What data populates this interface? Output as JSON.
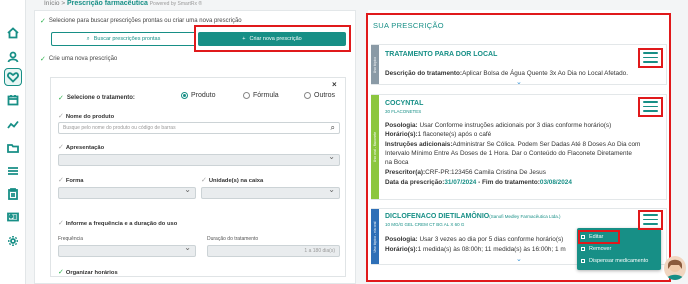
{
  "breadcrumb": {
    "home": "Início",
    "sep": ">",
    "current": "Prescrição farmacêutica",
    "powered": "Powered by SmartRx ®"
  },
  "sidebar_icons": [
    "home-icon",
    "user-icon",
    "heart-icon",
    "calendar-icon",
    "chart-icon",
    "folder-icon",
    "list-icon",
    "clipboard-icon",
    "id-card-icon",
    "settings-icon"
  ],
  "left": {
    "choose_label": "Selecione para buscar prescrições prontas ou criar uma nova prescrição",
    "search_btn": "Buscar prescrições prontas",
    "create_btn": "Criar nova prescrição",
    "new_label": "Crie uma nova prescrição",
    "close": "×",
    "treatment_label": "Selecione o tratamento:",
    "radios": [
      "Produto",
      "Fórmula",
      "Outros"
    ],
    "product_label": "Nome do produto",
    "product_placeholder": "Busque pelo nome do produto ou código de barras",
    "presentation_label": "Apresentação",
    "form_label": "Forma",
    "units_label": "Unidade(s) na caixa",
    "freq_section": "Informe a frequência e a duração do uso",
    "freq_label": "Frequência",
    "duration_label": "Duração do tratamento",
    "duration_value": "1 a 180 dia(s)",
    "organize_label": "Organizar horários"
  },
  "right": {
    "title": "SUA PRESCRIÇÃO",
    "cards": [
      {
        "strip_label": "Uso tópico",
        "strip_color": "#8a9aa6",
        "title": "TRATAMENTO PARA DOR LOCAL",
        "desc_label": "Descrição do tratamento:",
        "desc_value": "Aplicar Bolsa de Água Quente 3x Ao Dia no Local Afetado."
      },
      {
        "strip_label": "Uso oral - flaconete",
        "strip_color": "#8cc63f",
        "title": "COCYNTAL",
        "subtitle": "30 FLACONETES",
        "posology_label": "Posologia:",
        "posology_value": "Usar Conforme instruções adicionais por 3 dias conforme horário(s)",
        "hours_label": "Horário(s):",
        "hours_value": "1 flaconete(s) após o café",
        "instr_label": "Instruções adicionais:",
        "instr_value_1": "Administrar Se Cólica. Podem Ser Dadas Até 8 Doses Ao Dia com",
        "instr_value_2": "Intervalo Mínimo Entre As Doses de 1 Hora. Dar o Conteúdo do Flaconete Diretamente",
        "instr_value_3": "na Boca",
        "prescriber_label": "Prescritor(a):",
        "prescriber_value": "CRF-PR:123456 Camila Cristina De Jesus",
        "date_label": "Data da prescrição:",
        "date_value": "31/07/2024",
        "end_label": "Fim do tratamento:",
        "end_value": "03/08/2024"
      },
      {
        "strip_label": "Uso tópico - via oral",
        "strip_color": "#2e6fb7",
        "title": "DICLOFENACO DIETILAMÔNIO",
        "title_suffix": "(Sanofi Medley Farmacêutica Ltda.)",
        "subtitle": "10 MG/G GEL CREM CT BG AL X 60 G",
        "posology_label": "Posologia:",
        "posology_value": "Usar 3 vezes ao dia por 5 dias conforme horário(s)",
        "hours_label": "Horário(s):",
        "hours_value": "1 medida(s) às 08:00h; 11 medida(s) às 16:00h; 1 m"
      }
    ],
    "menu": [
      "Editar",
      "Remover",
      "Dispensar medicamento"
    ]
  }
}
